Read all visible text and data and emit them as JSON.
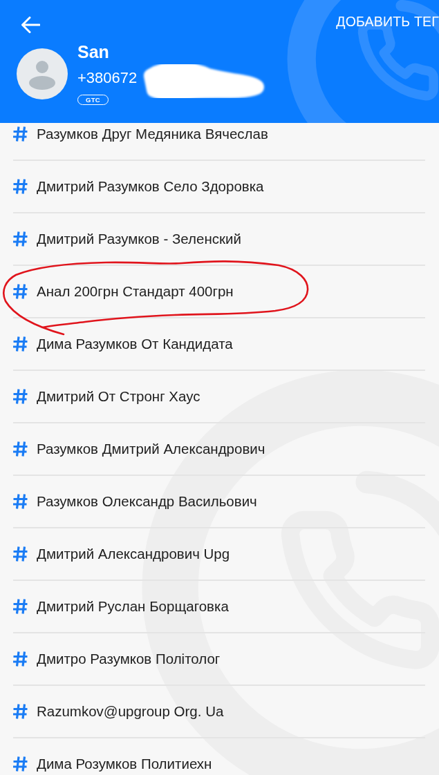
{
  "header": {
    "action": "ДОБАВИТЬ ТЕГ",
    "contact": {
      "name": "San",
      "phone": "+380672",
      "badge": "GTC"
    }
  },
  "tags": [
    {
      "label": "Разумков Друг Медяника Вячеслав",
      "circled": false
    },
    {
      "label": "Дмитрий Разумков Село Здоровка",
      "circled": false
    },
    {
      "label": "Дмитрий Разумков - Зеленский",
      "circled": false
    },
    {
      "label": "Анал 200грн Стандарт 400грн",
      "circled": true
    },
    {
      "label": "Дима Разумков От Кандидата",
      "circled": false
    },
    {
      "label": "Дмитрий От Стронг Хаус",
      "circled": false
    },
    {
      "label": "Разумков Дмитрий Александрович",
      "circled": false
    },
    {
      "label": "Разумков Олександр Васильович",
      "circled": false
    },
    {
      "label": "Дмитрий Александрович Upg",
      "circled": false
    },
    {
      "label": "Дмитрий Руслан Борщаговка",
      "circled": false
    },
    {
      "label": "Дмитро Разумков Політолог",
      "circled": false
    },
    {
      "label": "Razumkov@upgroup Org. Ua",
      "circled": false
    },
    {
      "label": "Дима Розумков Политиехн",
      "circled": false
    }
  ]
}
